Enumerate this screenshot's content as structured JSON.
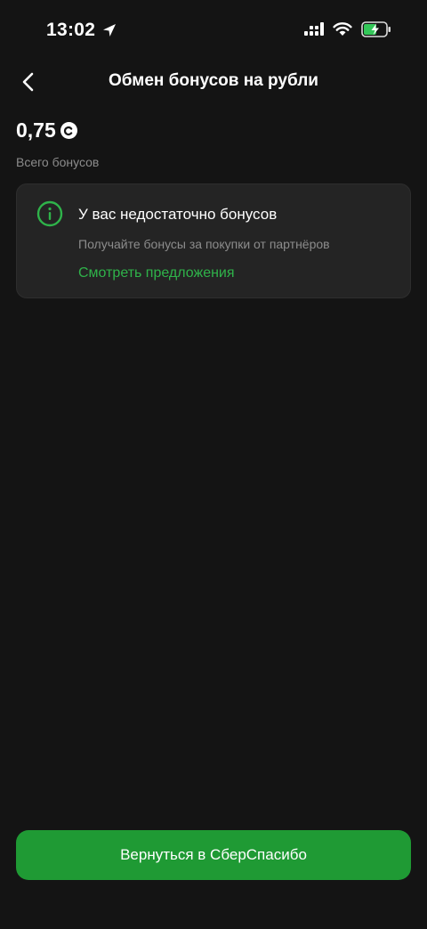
{
  "status_bar": {
    "time": "13:02",
    "icons": [
      "location-arrow-icon",
      "signal-icon",
      "wifi-icon",
      "battery-charging-icon"
    ]
  },
  "nav": {
    "back_icon": "chevron-left-icon",
    "title": "Обмен бонусов на рубли"
  },
  "balance": {
    "amount": "0,75",
    "coin_icon": "sberspasibo-coin-icon",
    "caption": "Всего бонусов"
  },
  "info_card": {
    "icon": "info-circle-icon",
    "title": "У вас недостаточно бонусов",
    "text": "Получайте бонусы за покупки от партнёров",
    "link_label": "Смотреть предложения"
  },
  "footer": {
    "button_label": "Вернуться в СберСпасибо"
  },
  "colors": {
    "background": "#141414",
    "card": "#242424",
    "accent_green": "#2fb34a",
    "button_green": "#1f9a34",
    "muted_text": "#8c8c8c"
  }
}
